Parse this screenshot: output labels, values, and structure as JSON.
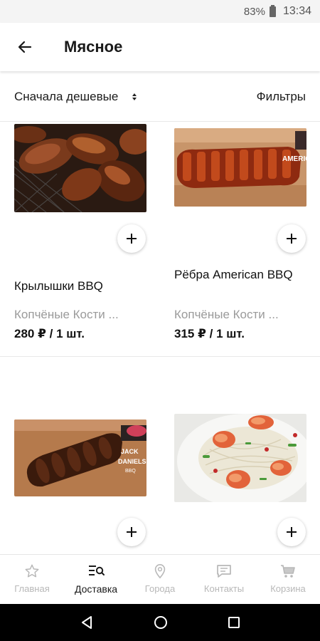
{
  "status_bar": {
    "battery": "83%",
    "time": "13:34"
  },
  "header": {
    "title": "Мясное"
  },
  "toolbar": {
    "sort_label": "Сначала дешевые",
    "filter_label": "Фильтры"
  },
  "products": [
    {
      "name": "Крылышки BBQ",
      "description": "Копчёные Кости ...",
      "price": "280 ₽ / 1 шт."
    },
    {
      "name": "Рёбра American BBQ",
      "description": "Копчёные Кости ...",
      "price": "315 ₽ / 1 шт."
    },
    {
      "name": "",
      "description": "",
      "price": ""
    },
    {
      "name": "",
      "description": "",
      "price": ""
    }
  ],
  "image_labels": {
    "american": "AMERICAN BBQ",
    "jack_line1": "JACK",
    "jack_line2": "DANIELS",
    "jack_line3": "BBQ"
  },
  "bottom_nav": [
    {
      "label": "Главная",
      "icon": "star-icon"
    },
    {
      "label": "Доставка",
      "icon": "menu-search-icon"
    },
    {
      "label": "Города",
      "icon": "location-pin-icon"
    },
    {
      "label": "Контакты",
      "icon": "chat-icon"
    },
    {
      "label": "Корзина",
      "icon": "cart-icon"
    }
  ],
  "colors": {
    "accent": "#1a1a1a",
    "inactive": "#b8b8b8",
    "muted_text": "#9a9a9a"
  }
}
